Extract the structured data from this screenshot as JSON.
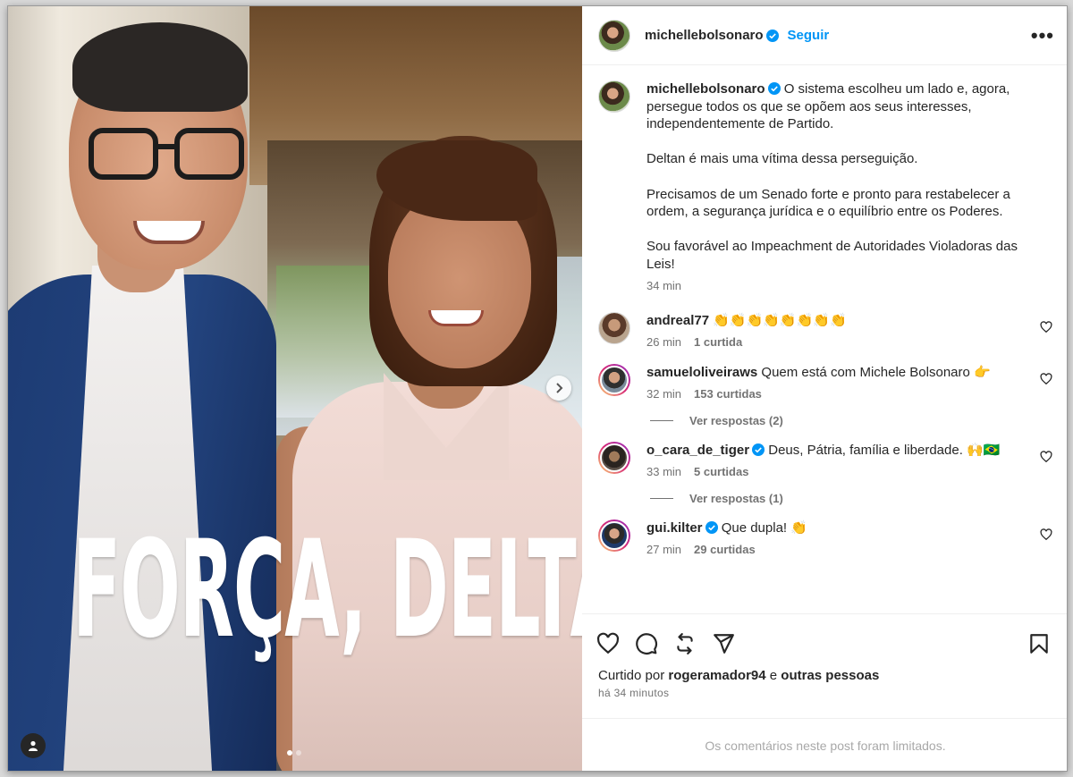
{
  "post": {
    "username": "michellebolsonaro",
    "follow_label": "Seguir",
    "more_label": "•••",
    "image_text": "FORÇA, DELTAN !",
    "caption": {
      "p1": "O sistema escolheu um lado e, agora, persegue todos os que se opõem aos seus interesses, independentemente de Partido.",
      "p2": "Deltan é mais uma vítima dessa perseguição.",
      "p3": "Precisamos de um Senado forte e pronto para restabelecer a ordem, a segurança jurídica e o equilíbrio entre os Poderes.",
      "p4": "Sou favorável ao Impeachment de Autoridades Violadoras das Leis!",
      "time": "34 min"
    },
    "carousel": {
      "current": 1,
      "total": 2
    }
  },
  "comments": [
    {
      "user": "andreal77",
      "text": "👏👏👏👏👏👏👏👏",
      "time": "26 min",
      "likes": "1 curtida",
      "replies": ""
    },
    {
      "user": "samueloliveiraws",
      "text": "Quem está com Michele Bolsonaro 👉",
      "time": "32 min",
      "likes": "153 curtidas",
      "replies": "Ver respostas (2)"
    },
    {
      "user": "o_cara_de_tiger",
      "text": "Deus, Pátria, família e liberdade. 🙌🇧🇷",
      "time": "33 min",
      "likes": "5 curtidas",
      "replies": "Ver respostas (1)"
    },
    {
      "user": "gui.kilter",
      "text": "Que dupla! 👏",
      "time": "27 min",
      "likes": "29 curtidas",
      "replies": ""
    }
  ],
  "footer": {
    "liked_prefix": "Curtido por",
    "liked_user": "rogeramador94",
    "liked_and": "e",
    "liked_others": "outras pessoas",
    "posted_ago": "há 34 minutos",
    "limited_notice": "Os comentários neste post foram limitados."
  },
  "colors": {
    "accent": "#0095f6",
    "muted": "#737373",
    "text": "#262626"
  }
}
